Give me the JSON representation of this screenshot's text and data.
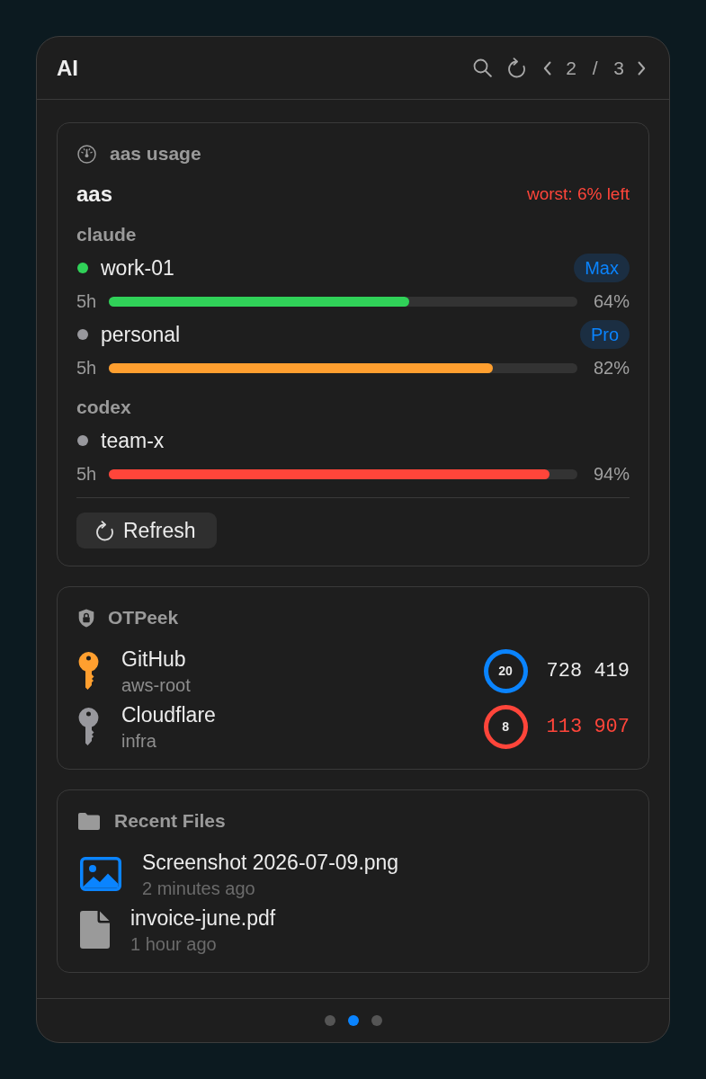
{
  "window": {
    "title": "AI",
    "page": "2 / 3"
  },
  "usage": {
    "title": "aas usage",
    "name": "aas",
    "summary": "worst: 6% left",
    "sections": [
      {
        "label": "claude",
        "accounts": [
          {
            "name": "work-01",
            "color": "#30d158",
            "plan": "Max",
            "window": "5h",
            "level": 0.64,
            "reading": "64%"
          },
          {
            "name": "personal",
            "color": "#98989d",
            "plan": "Pro",
            "window": "5h",
            "level": 0.82,
            "reading": "82%"
          }
        ]
      },
      {
        "label": "codex",
        "accounts": [
          {
            "name": "team-x",
            "color": "#98989d",
            "window": "5h",
            "level": 0.94,
            "reading": "94%"
          }
        ]
      }
    ],
    "refresh_button": "Refresh"
  },
  "otp": {
    "title": "OTPeek",
    "entries": [
      {
        "name": "GitHub",
        "account": "aws-root",
        "color": "#ff9f2f",
        "seconds": "20",
        "code": "728 419",
        "expiring": false
      },
      {
        "name": "Cloudflare",
        "account": "infra",
        "color": "#98989d",
        "seconds": "8",
        "code": "113 907",
        "expiring": true
      }
    ]
  },
  "recent_files": {
    "title": "Recent Files",
    "files": [
      {
        "kind": "image",
        "name": "Screenshot 2026-07-09.png",
        "time": "2 minutes ago"
      },
      {
        "kind": "document",
        "name": "invoice-june.pdf",
        "time": "1 hour ago"
      }
    ]
  },
  "pager": [
    {
      "selected": false
    },
    {
      "selected": true
    },
    {
      "selected": false
    }
  ]
}
